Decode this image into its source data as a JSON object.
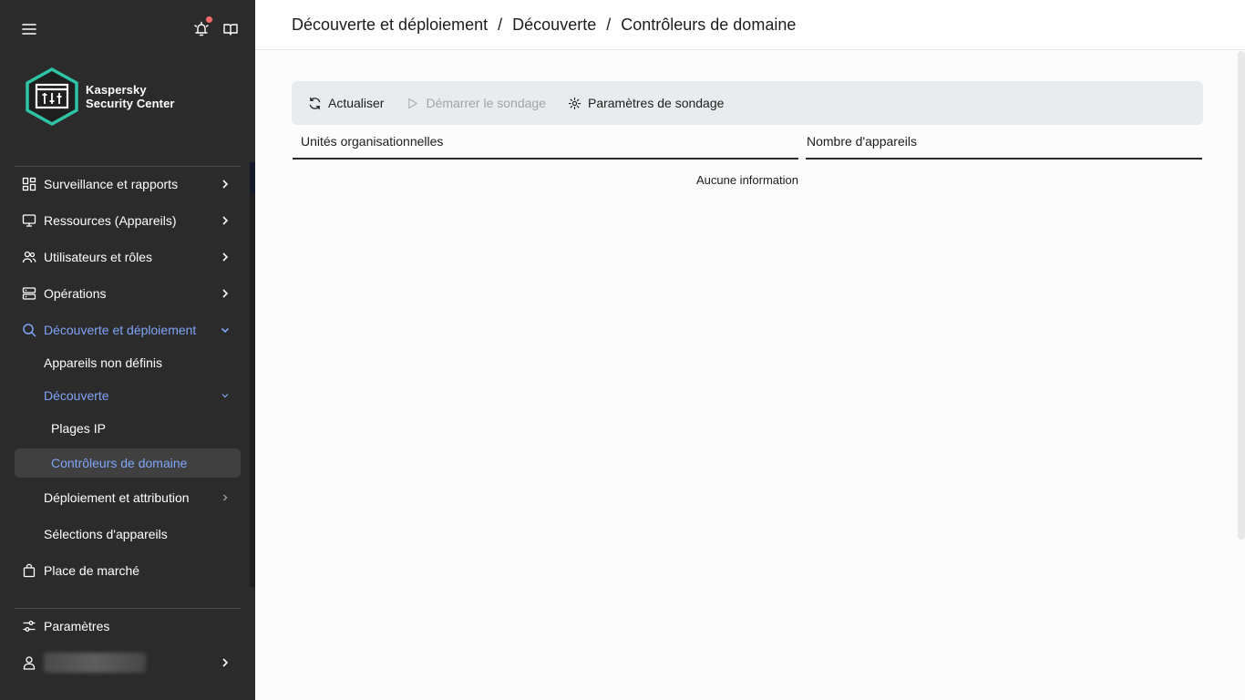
{
  "app": {
    "product_name_line1": "Kaspersky",
    "product_name_line2": "Security Center"
  },
  "colors": {
    "sidebar_bg": "#2b2b2b",
    "accent_blue": "#7ea5f8",
    "logo_teal": "#2ec4a6",
    "notification_dot": "#ff6b6b",
    "toolbar_bg": "#e9ecef"
  },
  "sidebar": {
    "top_icons": [
      "menu-icon",
      "notification-bell-icon",
      "book-icon"
    ],
    "items": [
      {
        "label": "Surveillance et rapports",
        "icon": "dashboard-icon",
        "chevron": "right"
      },
      {
        "label": "Ressources (Appareils)",
        "icon": "monitor-icon",
        "chevron": "right"
      },
      {
        "label": "Utilisateurs et rôles",
        "icon": "users-icon",
        "chevron": "right"
      },
      {
        "label": "Opérations",
        "icon": "server-icon",
        "chevron": "right"
      },
      {
        "label": "Découverte et déploiement",
        "icon": "search-icon",
        "chevron": "down",
        "state": "active"
      },
      {
        "label": "Appareils non définis",
        "level": 1
      },
      {
        "label": "Découverte",
        "level": 1,
        "chevron": "down",
        "state": "active"
      },
      {
        "label": "Plages IP",
        "level": 2
      },
      {
        "label": "Contrôleurs de domaine",
        "level": 2,
        "state": "selected"
      },
      {
        "label": "Déploiement et attribution",
        "level": 1,
        "chevron": "right"
      },
      {
        "label": "Sélections d'appareils",
        "level": 1
      },
      {
        "label": "Place de marché",
        "icon": "shopping-bag-icon"
      }
    ],
    "bottom": {
      "settings_label": "Paramètres",
      "settings_icon": "sliders-icon",
      "user_icon": "user-icon"
    }
  },
  "header": {
    "breadcrumb": [
      "Découverte et déploiement",
      "Découverte",
      "Contrôleurs de domaine"
    ],
    "separator": "/"
  },
  "toolbar": {
    "refresh_label": "Actualiser",
    "start_poll_label": "Démarrer le sondage",
    "poll_settings_label": "Paramètres de sondage"
  },
  "table": {
    "columns": [
      "Unités organisationnelles",
      "Nombre d'appareils"
    ],
    "rows": [],
    "empty_text": "Aucune information"
  }
}
